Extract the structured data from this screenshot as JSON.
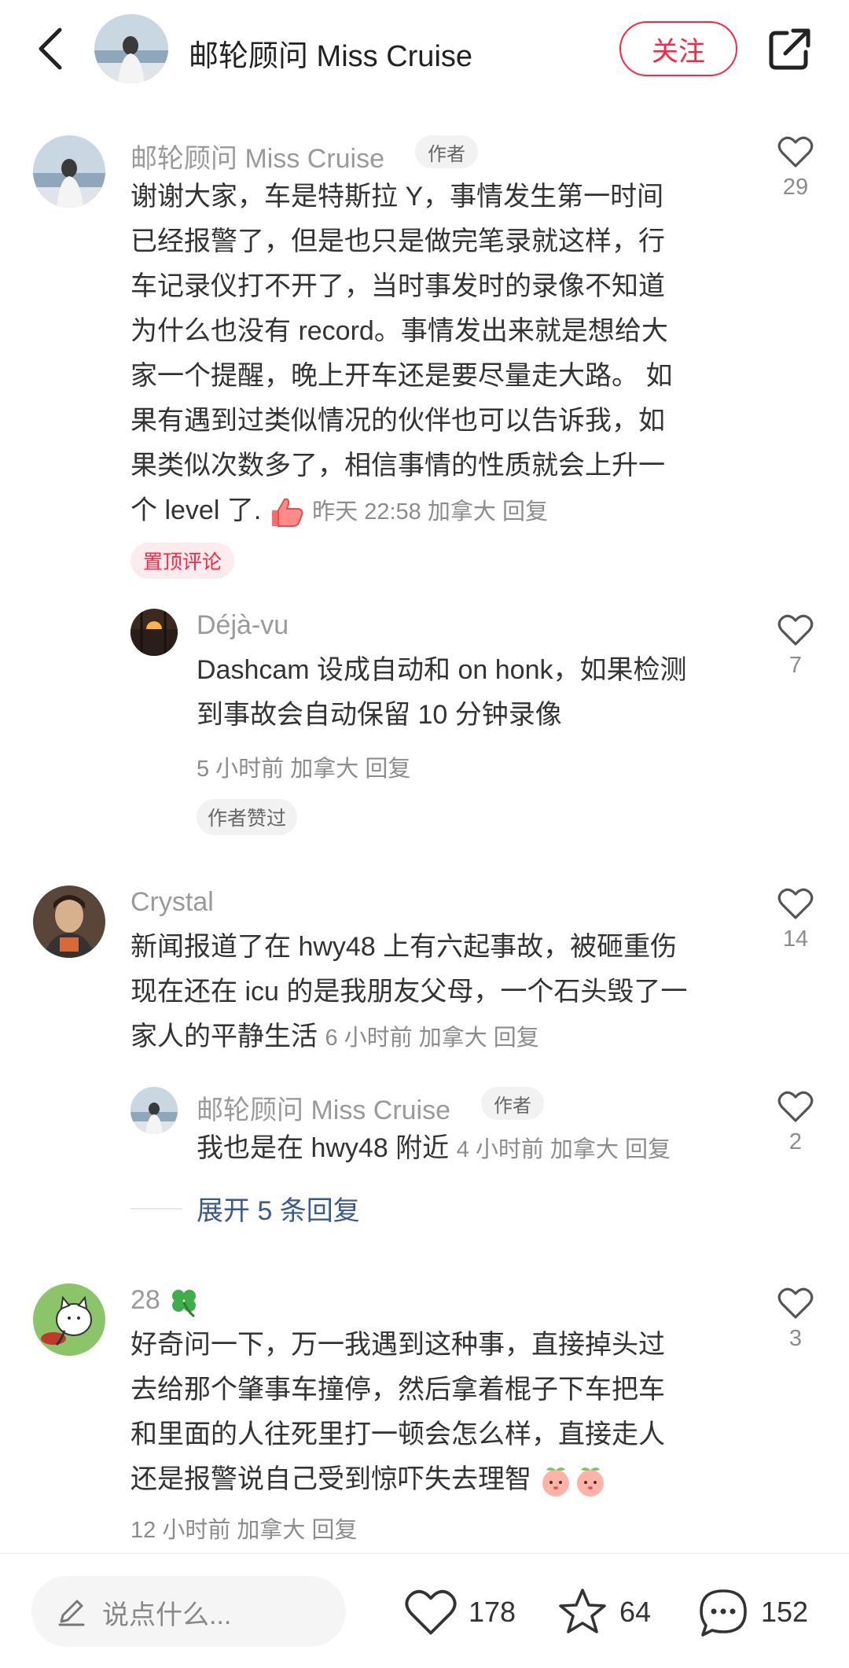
{
  "header": {
    "title": "邮轮顾问 Miss Cruise",
    "follow_label": "关注"
  },
  "comments": [
    {
      "author": "邮轮顾问 Miss Cruise",
      "author_tag": "作者",
      "text_lines": [
        "谢谢大家，车是特斯拉 Y，事情发生第一时间",
        "已经报警了，但是也只是做完笔录就这样，行",
        "车记录仪打不开了，当时事发时的录像不知道",
        "为什么也没有 record。事情发出来就是想给大",
        "家一个提醒，晚上开车还是要尽量走大路。 如",
        "果有遇到过类似情况的伙伴也可以告诉我，如",
        "果类似次数多了，相信事情的性质就会上升一"
      ],
      "last_line_text": "个 level 了.",
      "time": "昨天 22:58",
      "location": "加拿大",
      "reply_label": "回复",
      "likes": "29",
      "pinned_label": "置顶评论",
      "replies": [
        {
          "author": "Déjà-vu",
          "text_lines": [
            "Dashcam 设成自动和 on honk，如果检测",
            "到事故会自动保留 10 分钟录像"
          ],
          "time": "5 小时前",
          "location": "加拿大",
          "reply_label": "回复",
          "likes": "7",
          "badge": "作者赞过"
        }
      ]
    },
    {
      "author": "Crystal",
      "text_lines": [
        "新闻报道了在 hwy48 上有六起事故，被砸重伤",
        "现在还在 icu 的是我朋友父母，一个石头毁了一"
      ],
      "last_line_text": "家人的平静生活",
      "time": "6 小时前",
      "location": "加拿大",
      "reply_label": "回复",
      "likes": "14",
      "replies": [
        {
          "author": "邮轮顾问 Miss Cruise",
          "author_tag": "作者",
          "text": "我也是在 hwy48 附近",
          "time": "4 小时前",
          "location": "加拿大",
          "reply_label": "回复",
          "likes": "2"
        }
      ],
      "expand_label": "展开 5 条回复"
    },
    {
      "author": "28",
      "text_lines": [
        "好奇问一下，万一我遇到这种事，直接掉头过",
        "去给那个肇事车撞停，然后拿着棍子下车把车",
        "和里面的人往死里打一顿会怎么样，直接走人"
      ],
      "last_line_text": "还是报警说自己受到惊吓失去理智",
      "time": "12 小时前",
      "location": "加拿大",
      "reply_label": "回复",
      "likes": "3"
    }
  ],
  "bottom_bar": {
    "input_placeholder": "说点什么...",
    "likes": "178",
    "collects": "64",
    "comments": "152"
  },
  "icons": {
    "back": "chevron-left-icon",
    "share": "share-icon",
    "like": "heart-icon",
    "collect": "star-icon",
    "comment": "chat-bubble-icon",
    "edit": "pencil-icon",
    "thumbs_up_emoji": "thumbs-up-emoji",
    "peach_emoji": "peach-emoji",
    "clover_emoji": "four-leaf-clover-emoji"
  },
  "colors": {
    "accent": "#ff2442",
    "link": "#3a5a8c",
    "muted_text": "#8c8c8c"
  }
}
